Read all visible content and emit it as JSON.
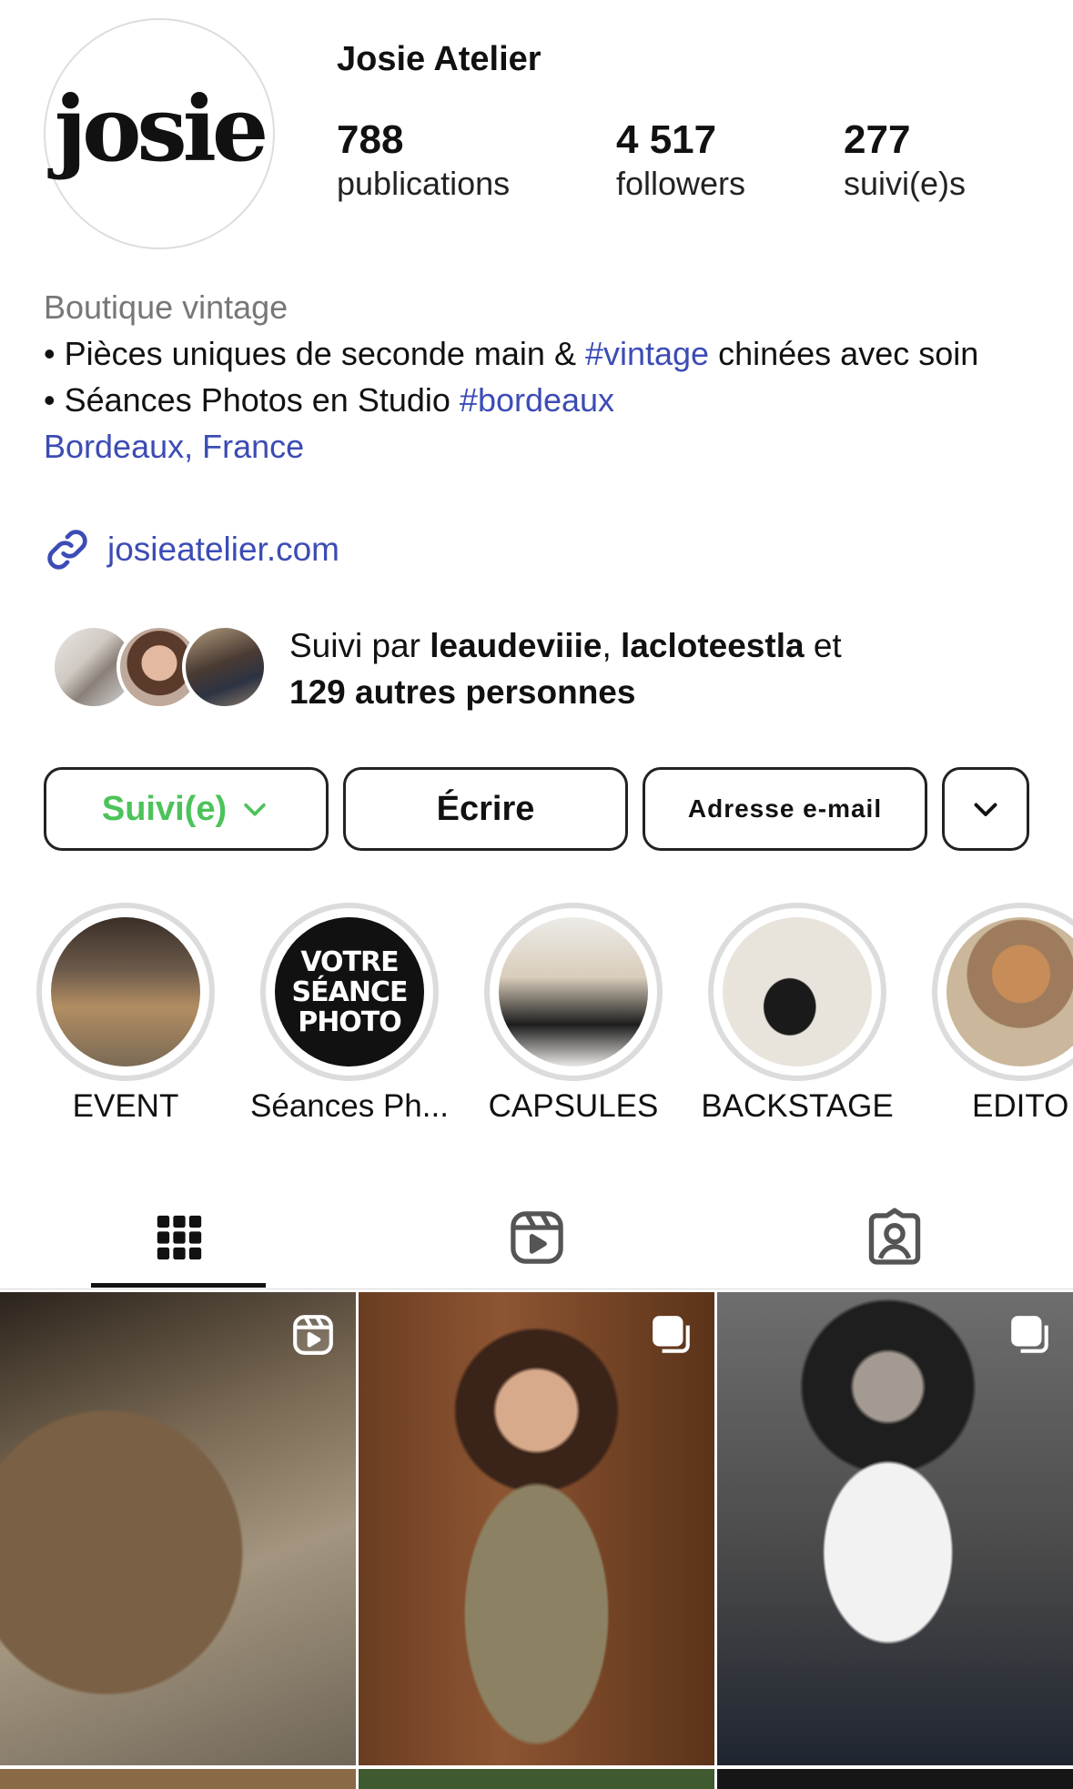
{
  "profile": {
    "avatar_text": "josie",
    "username": "Josie Atelier",
    "stats": [
      {
        "value": "788",
        "label": "publications"
      },
      {
        "value": "4 517",
        "label": "followers"
      },
      {
        "value": "277",
        "label": "suivi(e)s"
      }
    ]
  },
  "bio": {
    "category": "Boutique vintage",
    "line1_a": "• Pièces uniques de seconde main & ",
    "line1_tag": "#vintage",
    "line1_b": " chinées avec soin",
    "line2_a": "• Séances Photos en Studio ",
    "line2_tag": "#bordeaux",
    "location": "Bordeaux, France",
    "website": "josieatelier.com"
  },
  "followed_by": {
    "prefix": "Suivi par ",
    "user1": "leaudeviiie",
    "sep": ", ",
    "user2": "lacloteestla",
    "suffix": " et",
    "others": "129 autres personnes"
  },
  "actions": {
    "follow_label": "Suivi(e)",
    "write_label": "Écrire",
    "email_label": "Adresse e-mail"
  },
  "highlights": [
    {
      "label": "EVENT"
    },
    {
      "label": "Séances Ph...",
      "cover_text": [
        "VOTRE",
        "SÉANCE",
        "PHOTO"
      ]
    },
    {
      "label": "CAPSULES"
    },
    {
      "label": "BACKSTAGE"
    },
    {
      "label": "EDITO"
    }
  ],
  "tabs": [
    {
      "icon": "grid-icon",
      "active": true
    },
    {
      "icon": "reels-icon",
      "active": false
    },
    {
      "icon": "tagged-icon",
      "active": false
    }
  ],
  "posts": [
    {
      "type": "reel",
      "icon": "reel-icon"
    },
    {
      "type": "carousel",
      "icon": "carousel-icon"
    },
    {
      "type": "carousel",
      "icon": "carousel-icon"
    }
  ],
  "colors": {
    "link": "#3c4cb5",
    "follow_green": "#4cc35a",
    "text": "#111111",
    "muted": "#777777"
  }
}
